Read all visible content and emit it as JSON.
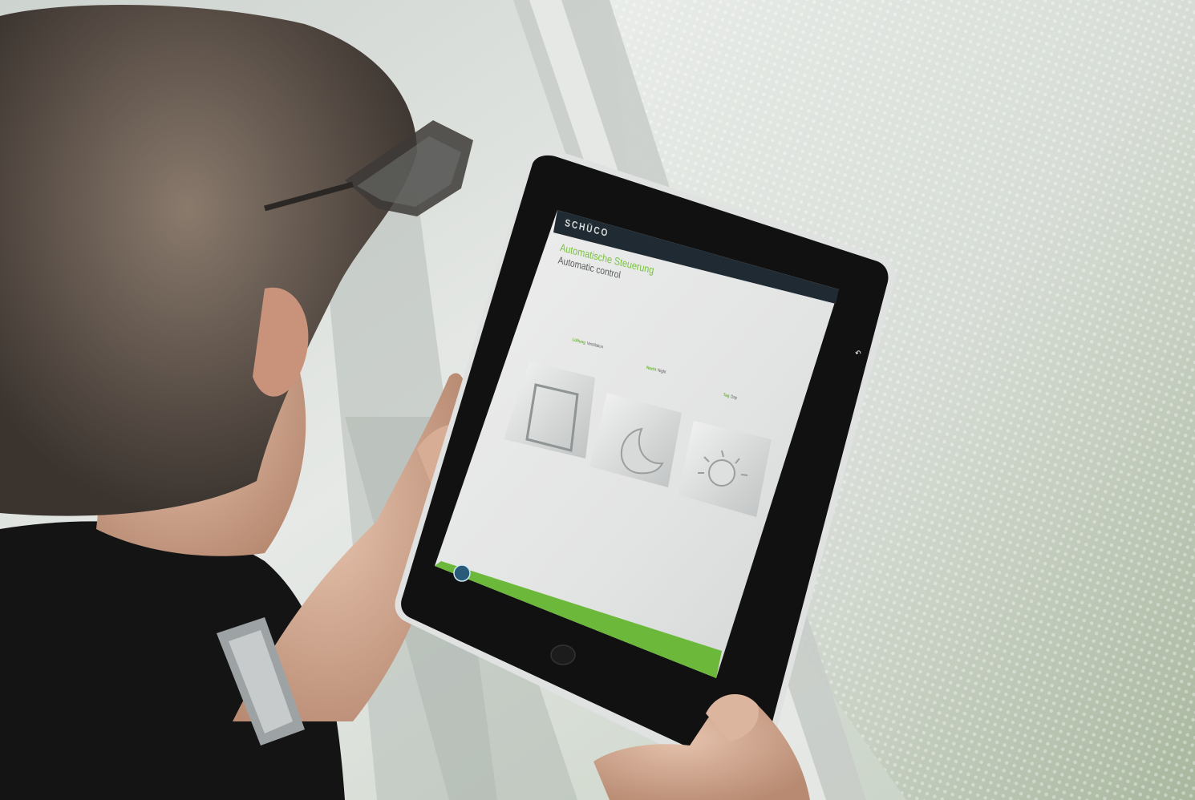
{
  "app": {
    "brand": "SCHÜCO",
    "title_de": "Automatische Steuerung",
    "title_en": "Automatic control"
  },
  "tiles": [
    {
      "label_de": "Lüftung",
      "label_en": "Ventilation",
      "icon": "window-icon"
    },
    {
      "label_de": "Nacht",
      "label_en": "Night",
      "icon": "moon-icon"
    },
    {
      "label_de": "Tag",
      "label_en": "Day",
      "icon": "sun-icon"
    }
  ],
  "footer": {
    "accent_color": "#6bb83a",
    "logo_icon": "globe-icon"
  },
  "colors": {
    "accent_green": "#7bc242",
    "screen_background": "#e4e6e6",
    "header_dark": "#1f2a33",
    "tablet_bezel": "#111111"
  }
}
